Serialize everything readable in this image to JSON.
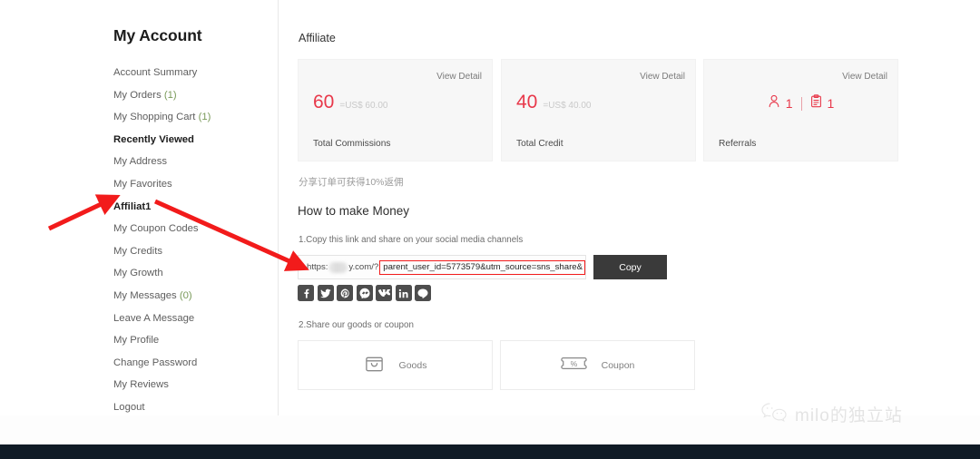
{
  "sidebar": {
    "title": "My Account",
    "items": [
      {
        "label": "Account Summary",
        "bold": false
      },
      {
        "label": "My Orders (1)",
        "bold": false
      },
      {
        "label": "My Shopping Cart (1)",
        "bold": false
      },
      {
        "label": "Recently Viewed",
        "bold": true
      },
      {
        "label": "My Address",
        "bold": false
      },
      {
        "label": "My Favorites",
        "bold": false
      },
      {
        "label": "Affiliat1",
        "bold": true
      },
      {
        "label": "My Coupon Codes",
        "bold": false
      },
      {
        "label": "My Credits",
        "bold": false
      },
      {
        "label": "My Growth",
        "bold": false
      },
      {
        "label": "My Messages (0)",
        "bold": false
      },
      {
        "label": "Leave A Message",
        "bold": false
      },
      {
        "label": "My Profile",
        "bold": false
      },
      {
        "label": "Change Password",
        "bold": false
      },
      {
        "label": "My Reviews",
        "bold": false
      },
      {
        "label": "Logout",
        "bold": false
      }
    ]
  },
  "main": {
    "heading": "Affiliate",
    "cards": [
      {
        "view_detail": "View Detail",
        "number": "60",
        "usd": "=US$ 60.00",
        "label": "Total Commissions"
      },
      {
        "view_detail": "View Detail",
        "number": "40",
        "usd": "=US$ 40.00",
        "label": "Total Credit"
      },
      {
        "view_detail": "View Detail",
        "person_count": "1",
        "order_count": "1",
        "label": "Referrals"
      }
    ],
    "cn_note": "分享订单可获得10%返佣",
    "how_heading": "How to make Money",
    "step1": "1.Copy this link and share on your social media channels",
    "url": {
      "prefix": "https:",
      "redacted": "",
      "suffix": "y.com/?",
      "highlighted": "parent_user_id=5773579&utm_source=sns_share&",
      "copy_label": "Copy"
    },
    "social_icons": [
      "facebook-icon",
      "twitter-icon",
      "pinterest-icon",
      "messenger-icon",
      "vk-icon",
      "linkedin-icon",
      "line-icon"
    ],
    "step2": "2.Share our goods or coupon",
    "share_boxes": [
      {
        "icon": "shopping-bag-icon",
        "label": "Goods"
      },
      {
        "icon": "coupon-percent-icon",
        "label": "Coupon"
      }
    ]
  },
  "watermark": {
    "text": "milo的独立站",
    "icon": "wechat-icon"
  },
  "colors": {
    "accent_red": "#e8384a",
    "annotation_red": "#f21b1b",
    "card_bg": "#f7f7f7",
    "copy_button": "#3a3a3a",
    "footer": "#101b26"
  }
}
